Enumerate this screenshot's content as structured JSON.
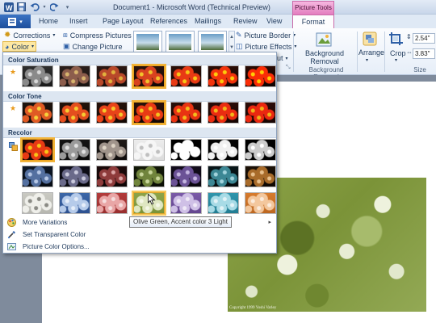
{
  "window": {
    "title": "Document1 - Microsoft Word (Technical Preview)",
    "contextual_tab": "Picture Tools"
  },
  "tabs": {
    "file": "",
    "home": "Home",
    "insert": "Insert",
    "page_layout": "Page Layout",
    "references": "References",
    "mailings": "Mailings",
    "review": "Review",
    "view": "View",
    "format": "Format"
  },
  "ribbon": {
    "corrections": "Corrections",
    "color": "Color",
    "compress": "Compress Pictures",
    "change": "Change Picture",
    "picture_border": "Picture Border",
    "picture_effects": "Picture Effects",
    "layout_partial": "ut",
    "background_removal": "Background Removal",
    "background_removal_line1": "Background",
    "background_removal_line2": "Removal",
    "background_removal_group": "Background Removal",
    "arrange": "Arrange",
    "crop": "Crop",
    "size_group": "Size",
    "height": "2.54\"",
    "width": "3.83\""
  },
  "dropdown": {
    "color_saturation": "Color Saturation",
    "color_tone": "Color Tone",
    "recolor": "Recolor",
    "more_variations": "More Variations",
    "set_transparent": "Set Transparent Color",
    "picture_color_options": "Picture Color Options...",
    "tooltip": "Olive Green, Accent color 3 Light"
  },
  "photo": {
    "copyright": "Copyright 1999 Yoshi Varley"
  },
  "colors": {
    "accent_format": "#e37dbf",
    "selection": "#f2b43b",
    "olive": "#8da349"
  }
}
